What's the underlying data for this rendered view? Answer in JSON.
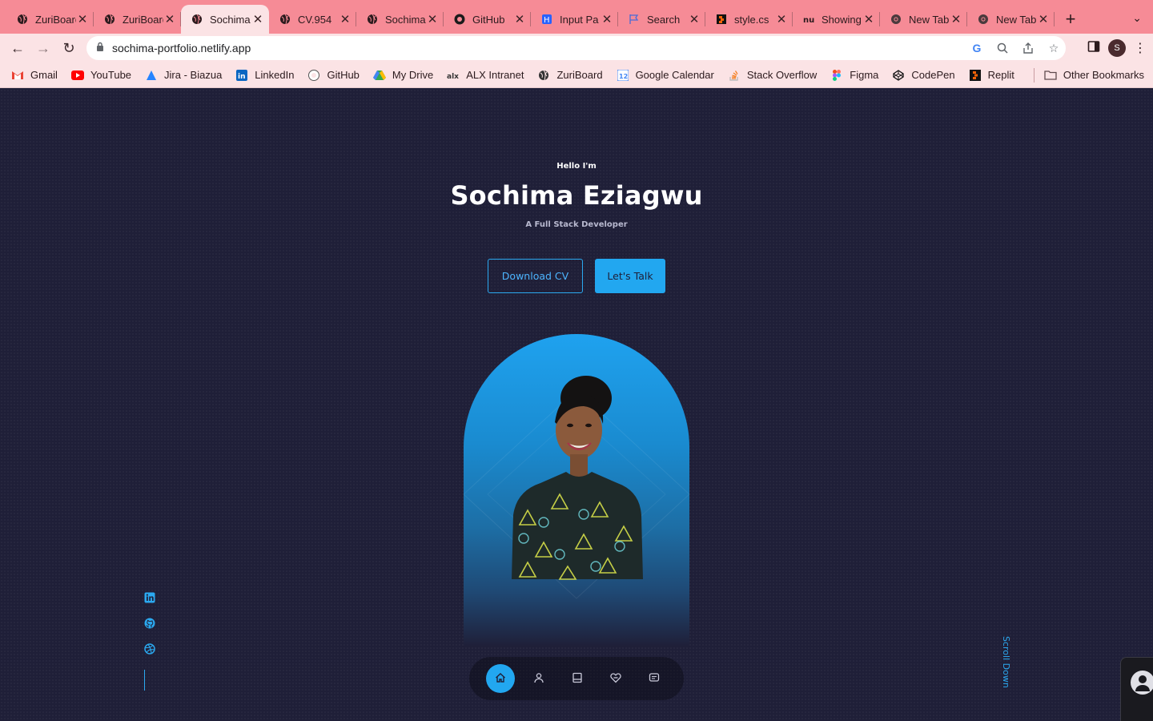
{
  "browser": {
    "tabs": [
      {
        "title": "ZuriBoard",
        "icon": "globe-icon",
        "active": false
      },
      {
        "title": "ZuriBoard",
        "icon": "globe-icon",
        "active": false
      },
      {
        "title": "Sochima",
        "icon": "globe-icon",
        "active": true
      },
      {
        "title": "CV.954",
        "icon": "globe-icon",
        "active": false
      },
      {
        "title": "Sochima",
        "icon": "globe-icon",
        "active": false
      },
      {
        "title": "GitHub",
        "icon": "github-icon",
        "active": false
      },
      {
        "title": "Input Pa",
        "icon": "hashnode-icon",
        "active": false
      },
      {
        "title": "Search",
        "icon": "flag-icon",
        "active": false
      },
      {
        "title": "style.cs",
        "icon": "replit-icon",
        "active": false
      },
      {
        "title": "Showing",
        "icon": "nu-icon",
        "active": false
      },
      {
        "title": "New Tab",
        "icon": "chrome-icon",
        "active": false
      },
      {
        "title": "New Tab",
        "icon": "chrome-icon",
        "active": false
      }
    ],
    "url": "sochima-portfolio.netlify.app",
    "profile_initial": "S",
    "bookmarks": [
      {
        "label": "Gmail",
        "icon": "gmail-icon",
        "color": "#ea4335"
      },
      {
        "label": "YouTube",
        "icon": "youtube-icon",
        "color": "#ff0000"
      },
      {
        "label": "Jira - Biazua",
        "icon": "jira-icon",
        "color": "#2684ff"
      },
      {
        "label": "LinkedIn",
        "icon": "linkedin-icon",
        "color": "#0a66c2"
      },
      {
        "label": "GitHub",
        "icon": "github-icon",
        "color": "#ffffff"
      },
      {
        "label": "My Drive",
        "icon": "drive-icon",
        "color": "#34a853"
      },
      {
        "label": "ALX Intranet",
        "icon": "alx-icon",
        "color": "#333333"
      },
      {
        "label": "ZuriBoard",
        "icon": "globe-icon",
        "color": "#333333"
      },
      {
        "label": "Google Calendar",
        "icon": "calendar-icon",
        "color": "#4285f4"
      },
      {
        "label": "Stack Overflow",
        "icon": "stackoverflow-icon",
        "color": "#f48024"
      },
      {
        "label": "Figma",
        "icon": "figma-icon",
        "color": "#a259ff"
      },
      {
        "label": "CodePen",
        "icon": "codepen-icon",
        "color": "#111111"
      },
      {
        "label": "Replit",
        "icon": "replit-icon",
        "color": "#f26207"
      }
    ],
    "other_bookmarks": "Other Bookmarks"
  },
  "hero": {
    "greeting": "Hello I'm",
    "name": "Sochima Eziagwu",
    "role": "A Full Stack Developer",
    "download_cv": "Download CV",
    "lets_talk": "Let's Talk",
    "scroll_down": "Scroll Down"
  },
  "socials": [
    {
      "icon": "linkedin-icon"
    },
    {
      "icon": "github-icon"
    },
    {
      "icon": "dribbble-icon"
    }
  ],
  "nav": [
    {
      "icon": "home-icon",
      "active": true
    },
    {
      "icon": "user-icon",
      "active": false
    },
    {
      "icon": "book-icon",
      "active": false
    },
    {
      "icon": "services-icon",
      "active": false
    },
    {
      "icon": "message-icon",
      "active": false
    }
  ],
  "colors": {
    "accent": "#22a7f0",
    "background": "#1f1f38",
    "chrome": "#f68b96",
    "toolbar": "#fbe3e5"
  }
}
